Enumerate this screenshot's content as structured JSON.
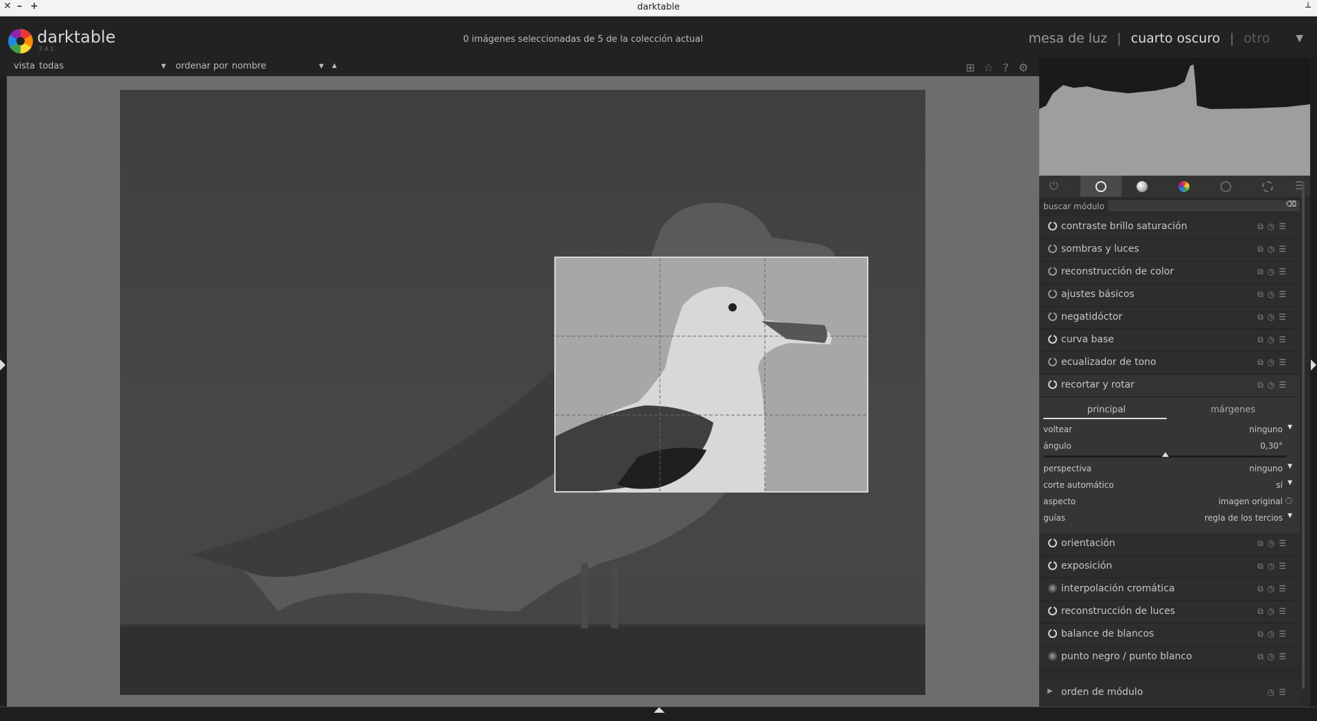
{
  "window": {
    "title": "darktable"
  },
  "header": {
    "app_name": "darktable",
    "version": "3.4.1",
    "selection_info": "0 imágenes seleccionadas de 5 de la colección actual",
    "views": {
      "lighttable": "mesa de luz",
      "darkroom": "cuarto oscuro",
      "other": "otro"
    }
  },
  "filterbar": {
    "view_label": "vista",
    "view_value": "todas",
    "sort_label": "ordenar por",
    "sort_value": "nombre"
  },
  "top_icons": [
    "grid-icon",
    "star-icon",
    "help-icon",
    "gear-icon"
  ],
  "module_groups": [
    "power-icon",
    "base-circle-icon",
    "tone-sphere-icon",
    "color-wheel-icon",
    "correct-icon",
    "effect-icon",
    "menu-icon"
  ],
  "search": {
    "label": "buscar módulo",
    "value": ""
  },
  "modules_top": [
    {
      "name": "contraste brillo saturación",
      "state": "on"
    },
    {
      "name": "sombras y luces",
      "state": "off"
    },
    {
      "name": "reconstrucción de color",
      "state": "off"
    },
    {
      "name": "ajustes básicos",
      "state": "off"
    },
    {
      "name": "negatidóctor",
      "state": "off"
    },
    {
      "name": "curva base",
      "state": "on"
    },
    {
      "name": "ecualizador de tono",
      "state": "off"
    },
    {
      "name": "recortar y rotar",
      "state": "on"
    }
  ],
  "crop_module": {
    "tabs": [
      "principal",
      "márgenes"
    ],
    "active_tab": "principal",
    "params": {
      "flip": {
        "label": "voltear",
        "value": "ninguno"
      },
      "angle": {
        "label": "ángulo",
        "value": "0,30°",
        "slider_fraction": 0.5
      },
      "perspective": {
        "label": "perspectiva",
        "value": "ninguno"
      },
      "autocrop": {
        "label": "corte automático",
        "value": "sí"
      },
      "aspect": {
        "label": "aspecto",
        "value": "imagen original"
      },
      "guides": {
        "label": "guías",
        "value": "regla de los tercios"
      }
    }
  },
  "modules_bottom": [
    {
      "name": "orientación",
      "state": "on"
    },
    {
      "name": "exposición",
      "state": "on"
    },
    {
      "name": "interpolación cromática",
      "state": "fixed"
    },
    {
      "name": "reconstrucción de luces",
      "state": "on"
    },
    {
      "name": "balance de blancos",
      "state": "on"
    },
    {
      "name": "punto negro / punto blanco",
      "state": "fixed"
    }
  ],
  "module_order": {
    "label": "orden de módulo"
  },
  "colors": {
    "background": "#1e1e1e",
    "panel": "#2a2a2a",
    "center_bg": "#6d6d6d",
    "text": "#c6c6c6"
  }
}
